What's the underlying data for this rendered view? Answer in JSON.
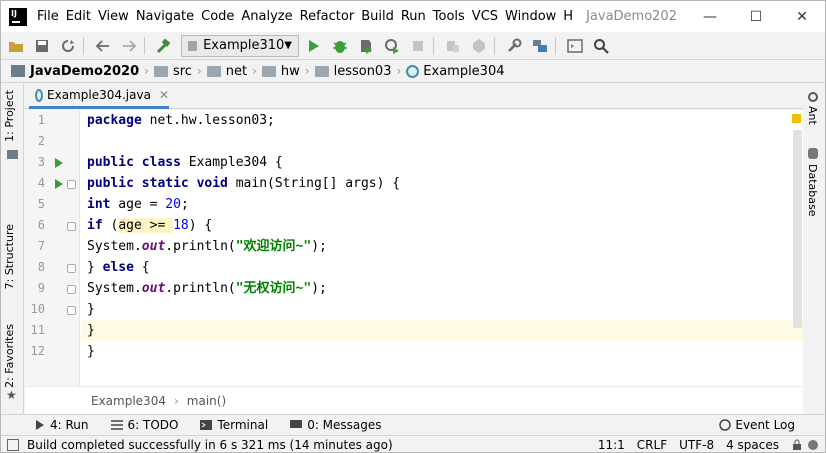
{
  "title_bar": {
    "menu": [
      "File",
      "Edit",
      "View",
      "Navigate",
      "Code",
      "Analyze",
      "Refactor",
      "Build",
      "Run",
      "Tools",
      "VCS",
      "Window",
      "H"
    ],
    "title": "JavaDemo202",
    "minimize": "—",
    "maximize": "☐",
    "close": "✕"
  },
  "toolbar": {
    "run_config": "Example310",
    "icons": [
      "save-all-icon",
      "sync-icon",
      "back-icon",
      "forward-icon",
      "build-icon",
      "run-icon",
      "debug-icon",
      "coverage-icon",
      "profile-icon",
      "stop-icon",
      "update-icon",
      "deploy-icon",
      "settings-icon",
      "project-structure-icon",
      "terminal-icon",
      "search-icon"
    ]
  },
  "navbar": {
    "project": "JavaDemo2020",
    "crumbs": [
      "src",
      "net",
      "hw",
      "lesson03",
      "Example304"
    ]
  },
  "left_strip": {
    "project": "1: Project",
    "structure": "7: Structure",
    "favorites": "2: Favorites"
  },
  "right_strip": {
    "ant": "Ant",
    "database": "Database"
  },
  "editor": {
    "file_tab": "Example304.java",
    "line_numbers": [
      "1",
      "2",
      "3",
      "4",
      "5",
      "6",
      "7",
      "8",
      "9",
      "10",
      "11",
      "12"
    ],
    "code": {
      "l1_a": "package",
      "l1_b": " net.hw.lesson03;",
      "l3_a": "public class",
      "l3_b": " Example304 {",
      "l4_a": "public static void",
      "l4_b": " main(String[] args) {",
      "l5_a": "int",
      "l5_b": " age = ",
      "l5_c": "20",
      "l5_d": ";",
      "l6_a": "if",
      "l6_b": " (",
      "l6_c": "age >= ",
      "l6_d": "18",
      "l6_e": ") {",
      "l7_a": "System.",
      "l7_b": "out",
      "l7_c": ".println(",
      "l7_d": "\"欢迎访问~\"",
      "l7_e": ");",
      "l8_a": "} ",
      "l8_b": "else",
      "l8_c": " {",
      "l9_a": "System.",
      "l9_b": "out",
      "l9_c": ".println(",
      "l9_d": "\"无权访问~\"",
      "l9_e": ");",
      "l10": "}",
      "l11": "}",
      "l12": "}"
    },
    "breadcrumb": [
      "Example304",
      "main()"
    ],
    "breadcrumb_sep": "›"
  },
  "tool_windows": {
    "run": "4: Run",
    "todo": "6: TODO",
    "terminal": "Terminal",
    "messages": "0: Messages",
    "event_log": "Event Log"
  },
  "status_bar": {
    "message": "Build completed successfully in 6 s 321 ms (14 minutes ago)",
    "position": "11:1",
    "line_sep": "CRLF",
    "encoding": "UTF-8",
    "indent": "4 spaces"
  }
}
